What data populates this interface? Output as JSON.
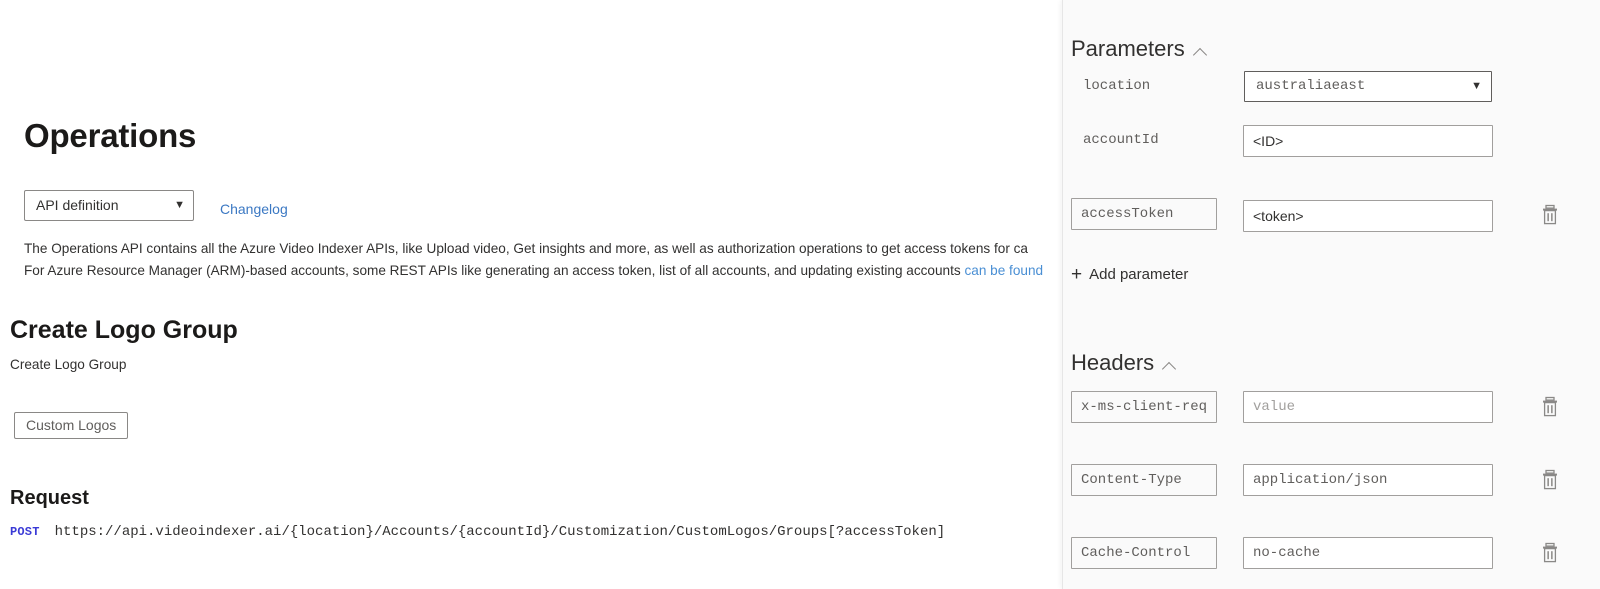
{
  "document": {
    "page_title": "Operations",
    "api_definition_select": {
      "selected": "API definition",
      "options": [
        "API definition"
      ],
      "chevron_icon": "chevron-down-icon"
    },
    "changelog_link": "Changelog",
    "description_line_1": "The Operations API contains all the Azure Video Indexer APIs, like Upload video, Get insights and more, as well as authorization operations to get access tokens for ca",
    "description_line_2_before_link": "For Azure Resource Manager (ARM)-based accounts, some REST APIs like generating an access token, list of all accounts, and updating existing accounts ",
    "description_line_2_link": "can be found",
    "operation_title": "Create Logo Group",
    "operation_subtitle": "Create Logo Group",
    "tag_button": "Custom Logos",
    "request_heading": "Request",
    "request_method": "POST",
    "request_url": "https://api.videoindexer.ai/{location}/Accounts/{accountId}/Customization/CustomLogos/Groups[?accessToken]"
  },
  "console": {
    "parameters": {
      "heading": "Parameters",
      "collapse_icon": "chevron-up-icon",
      "fixed_rows": [
        {
          "label": "location",
          "control": "select",
          "value": "australiaeast",
          "chevron_icon": "chevron-down-icon"
        },
        {
          "label": "accountId",
          "control": "text",
          "value": "<ID>"
        }
      ],
      "custom_rows": [
        {
          "key": "accessToken",
          "value": "<token>",
          "delete_icon": "trash-icon"
        }
      ],
      "add_button": {
        "label": "Add parameter",
        "icon": "plus-icon"
      }
    },
    "headers": {
      "heading": "Headers",
      "collapse_icon": "chevron-up-icon",
      "rows": [
        {
          "key": "x-ms-client-req",
          "value": "value",
          "value_is_placeholder": true,
          "delete_icon": "trash-icon"
        },
        {
          "key": "Content-Type",
          "value": "application/json",
          "value_is_placeholder": false,
          "delete_icon": "trash-icon"
        },
        {
          "key": "Cache-Control",
          "value": "no-cache",
          "value_is_placeholder": false,
          "delete_icon": "trash-icon"
        }
      ]
    }
  },
  "colors": {
    "link": "#3b78c3",
    "method": "#3a3ad6",
    "panel_bg": "#fafafa",
    "text": "#323130"
  }
}
